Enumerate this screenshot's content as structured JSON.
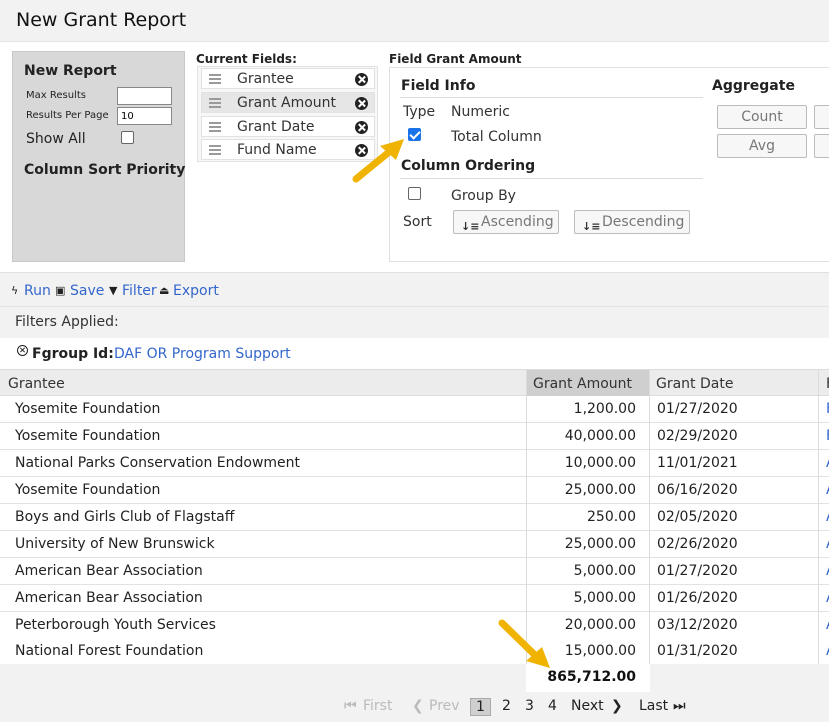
{
  "page": {
    "title": "New Grant Report"
  },
  "left_panel": {
    "title": "New Report",
    "max_results_label": "Max Results",
    "max_results_value": "",
    "results_per_page_label": "Results Per Page",
    "results_per_page_value": "10",
    "show_all_label": "Show All",
    "sort_priority_label": "Column Sort Priority"
  },
  "current_fields": {
    "title": "Current Fields:",
    "items": [
      {
        "label": "Grantee"
      },
      {
        "label": "Grant Amount"
      },
      {
        "label": "Grant Date"
      },
      {
        "label": "Fund Name"
      }
    ]
  },
  "field_panel": {
    "title": "Field Grant Amount",
    "field_info_title": "Field Info",
    "type_label": "Type",
    "type_value": "Numeric",
    "total_column_label": "Total Column",
    "column_ordering_title": "Column Ordering",
    "group_by_label": "Group By",
    "sort_label": "Sort",
    "ascending_label": "Ascending",
    "descending_label": "Descending",
    "aggregate_title": "Aggregate",
    "count_label": "Count",
    "avg_label": "Avg"
  },
  "toolbar": {
    "run": "Run",
    "save": "Save",
    "filter": "Filter",
    "export": "Export"
  },
  "filters": {
    "label": "Filters Applied:",
    "fgroup_label": "Fgroup Id:",
    "fgroup_value": "DAF OR Program Support"
  },
  "table": {
    "columns": [
      "Grantee",
      "Grant Amount",
      "Grant Date",
      "F"
    ],
    "rows": [
      {
        "grantee": "Yosemite Foundation",
        "amount": "1,200.00",
        "date": "01/27/2020",
        "fund": "F"
      },
      {
        "grantee": "Yosemite Foundation",
        "amount": "40,000.00",
        "date": "02/29/2020",
        "fund": "F"
      },
      {
        "grantee": "National Parks Conservation Endowment",
        "amount": "10,000.00",
        "date": "11/01/2021",
        "fund": "A"
      },
      {
        "grantee": "Yosemite Foundation",
        "amount": "25,000.00",
        "date": "06/16/2020",
        "fund": "A"
      },
      {
        "grantee": "Boys and Girls Club of Flagstaff",
        "amount": "250.00",
        "date": "02/05/2020",
        "fund": "A"
      },
      {
        "grantee": "University of New Brunswick",
        "amount": "25,000.00",
        "date": "02/26/2020",
        "fund": "A"
      },
      {
        "grantee": "American Bear Association",
        "amount": "5,000.00",
        "date": "01/27/2020",
        "fund": "A"
      },
      {
        "grantee": "American Bear Association",
        "amount": "5,000.00",
        "date": "01/26/2020",
        "fund": "A"
      },
      {
        "grantee": "Peterborough Youth Services",
        "amount": "20,000.00",
        "date": "03/12/2020",
        "fund": "A"
      },
      {
        "grantee": "National Forest Foundation",
        "amount": "15,000.00",
        "date": "01/31/2020",
        "fund": "A"
      }
    ],
    "total": "865,712.00"
  },
  "pager": {
    "first": "First",
    "prev": "Prev",
    "pages": [
      "1",
      "2",
      "3",
      "4"
    ],
    "next": "Next",
    "last": "Last"
  },
  "colors": {
    "link": "#3366cc",
    "arrow": "#f0b400",
    "checkbox": "#1a73e8"
  }
}
